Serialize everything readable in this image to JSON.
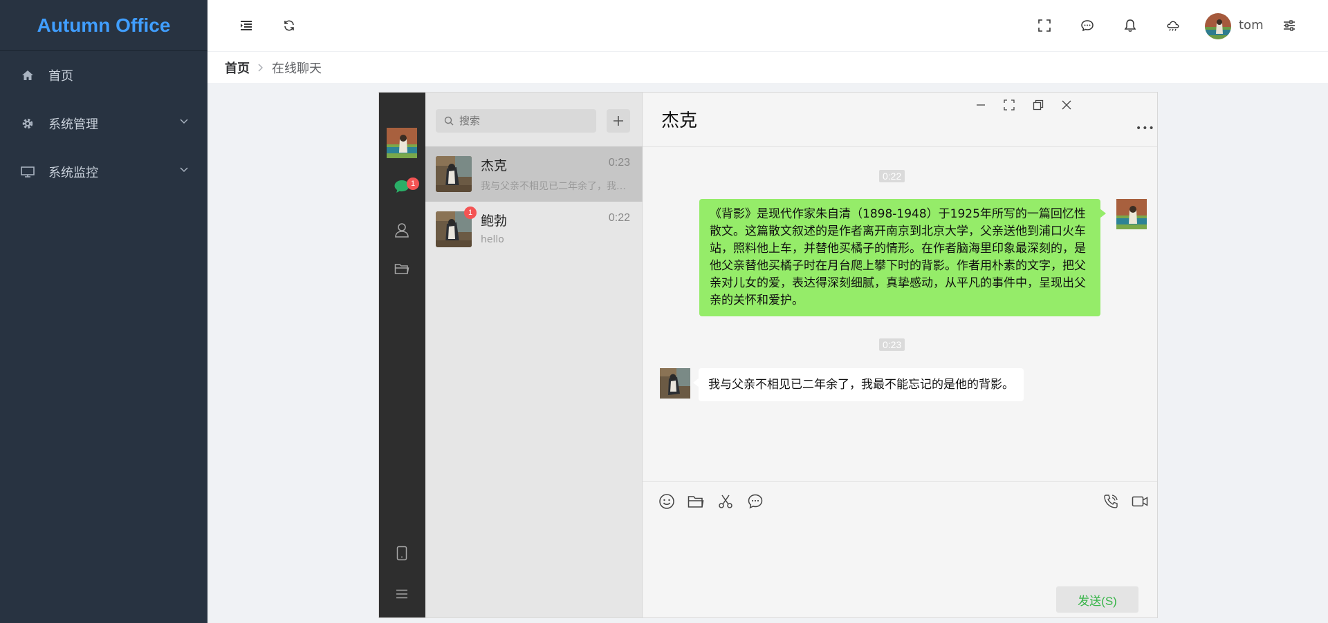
{
  "app": {
    "title": "Autumn Office"
  },
  "sidebar": {
    "items": [
      {
        "label": "首页",
        "icon": "home-icon"
      },
      {
        "label": "系统管理",
        "icon": "gear-icon",
        "expandable": true
      },
      {
        "label": "系统监控",
        "icon": "monitor-icon",
        "expandable": true
      }
    ]
  },
  "header": {
    "icons": [
      "menu-fold-icon",
      "refresh-icon",
      "fullscreen-icon",
      "chat-icon",
      "bell-icon",
      "weather-icon",
      "settings-sliders-icon"
    ],
    "username": "tom"
  },
  "breadcrumb": {
    "home": "首页",
    "current": "在线聊天"
  },
  "chat": {
    "rail": {
      "unread_chats": "1"
    },
    "search": {
      "placeholder": "搜索"
    },
    "conversations": [
      {
        "name": "杰克",
        "time": "0:23",
        "preview": "我与父亲不相见已二年余了，我最不能忘记的是他的背影。",
        "active": true,
        "unread": ""
      },
      {
        "name": "鲍勃",
        "time": "0:22",
        "preview": "hello",
        "active": false,
        "unread": "1"
      }
    ],
    "active_contact": "杰克",
    "more_label": "•••",
    "messages": [
      {
        "time": "0:22",
        "from": "self",
        "text": "《背影》是现代作家朱自清（1898-1948）于1925年所写的一篇回忆性散文。这篇散文叙述的是作者离开南京到北京大学，父亲送他到浦口火车站，照料他上车，并替他买橘子的情形。在作者脑海里印象最深刻的，是他父亲替他买橘子时在月台爬上攀下时的背影。作者用朴素的文字，把父亲对儿女的爱，表达得深刻细腻，真挚感动，从平凡的事件中，呈现出父亲的关怀和爱护。"
      },
      {
        "time": "0:23",
        "from": "other",
        "text": "我与父亲不相见已二年余了，我最不能忘记的是他的背影。"
      }
    ],
    "send_label": "发送(S)"
  },
  "colors": {
    "sidebar_bg": "#283341",
    "brand": "#409eff",
    "bubble_self": "#95ec69",
    "send_text": "#39b54a",
    "badge": "#f45454"
  }
}
